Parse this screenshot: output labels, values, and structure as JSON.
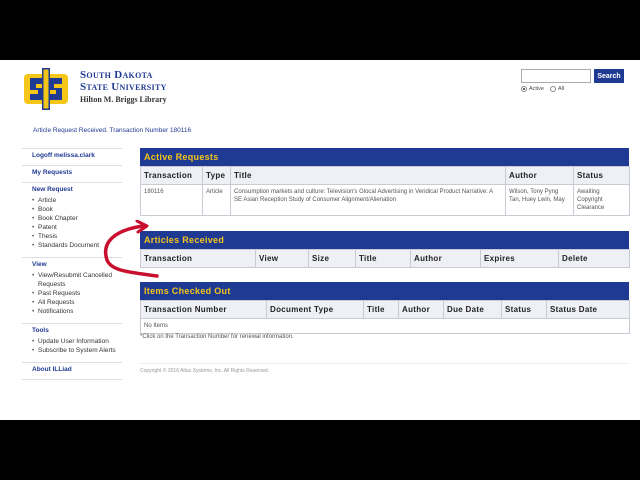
{
  "header": {
    "university_line1": "South Dakota",
    "university_line2": "State University",
    "library_name": "Hilton M. Briggs Library",
    "logo_letters": "SJS"
  },
  "search": {
    "value": "",
    "placeholder": "",
    "button_label": "Search",
    "option_active": "Active",
    "option_all": "All",
    "selected": "Active"
  },
  "status_message": "Article Request Received. Transaction Number 180116",
  "sidebar": {
    "logoff": "Logoff melissa.clark",
    "my_requests": "My Requests",
    "new_request": "New Request",
    "new_request_items": [
      "Article",
      "Book",
      "Book Chapter",
      "Patent",
      "Thesis",
      "Standards Document"
    ],
    "view": "View",
    "view_items": [
      "View/Resubmit Cancelled Requests",
      "Past Requests",
      "All Requests",
      "Notifications"
    ],
    "tools": "Tools",
    "tools_items": [
      "Update User Information",
      "Subscribe to System Alerts"
    ],
    "about": "About ILLiad"
  },
  "active_requests": {
    "title": "Active Requests",
    "columns": [
      "Transaction",
      "Type",
      "Title",
      "Author",
      "Status"
    ],
    "rows": [
      {
        "transaction": "180116",
        "type": "Article",
        "title": "Consumption markets and culture: Television's Glocal Advertising in Veridical Product Narrative: A SE Asian Reception Study of Consumer Alignment/Alienation",
        "author": "Wilson, Tony Pyng Tan, Huey Lwin, May",
        "status": "Awaiting Copyright Clearance"
      }
    ]
  },
  "articles_received": {
    "title": "Articles Received",
    "columns": [
      "Transaction",
      "View",
      "Size",
      "Title",
      "Author",
      "Expires",
      "Delete"
    ]
  },
  "items_checked_out": {
    "title": "Items Checked Out",
    "columns": [
      "Transaction Number",
      "Document Type",
      "Title",
      "Author",
      "Due Date",
      "Status",
      "Status Date"
    ],
    "empty_text": "No Items"
  },
  "note": "*Click on the Transaction Number for renewal information.",
  "copyright": "Copyright © 2016 Atlas Systems, Inc. All Rights Reserved.",
  "colors": {
    "brand_blue": "#1f3a93",
    "brand_gold": "#f5c518",
    "arrow_red": "#c8102e"
  }
}
